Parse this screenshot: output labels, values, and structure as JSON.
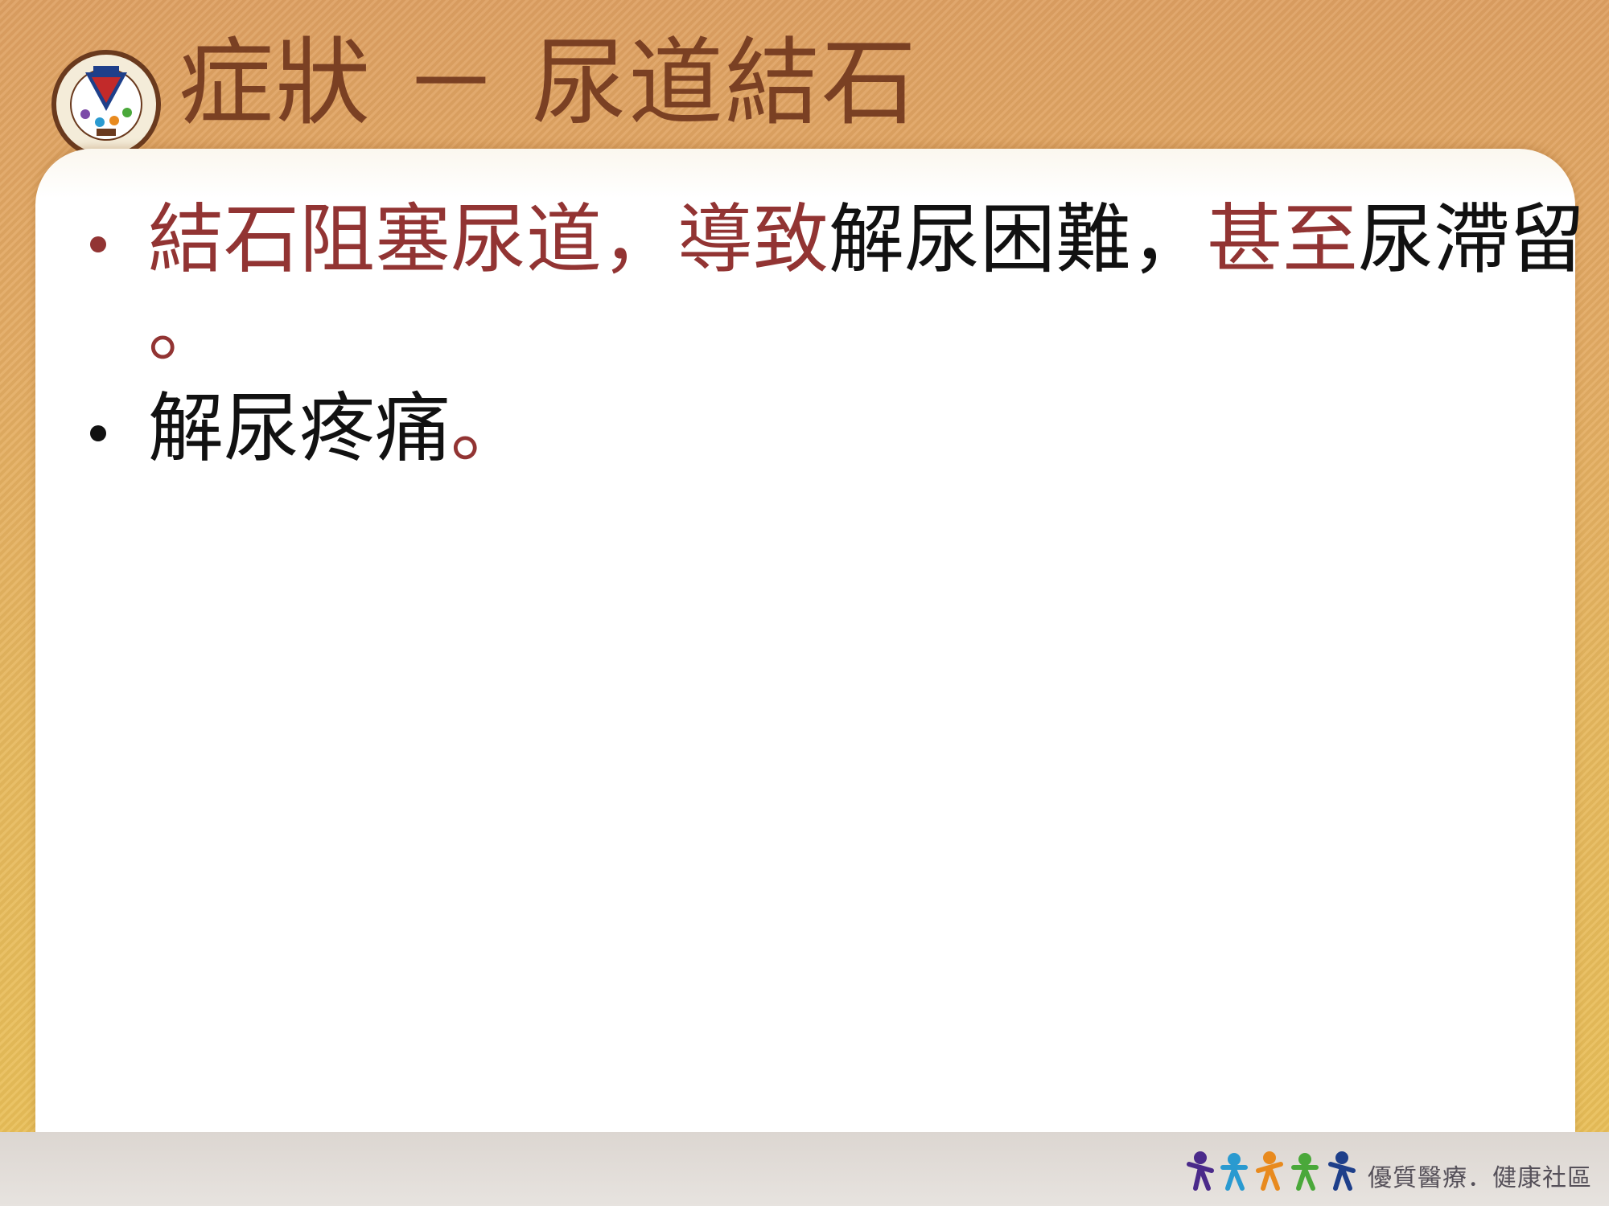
{
  "slide": {
    "title": "症狀 －  尿道結石"
  },
  "bullets": [
    {
      "line1": [
        {
          "text": "結石阻塞尿道，導致",
          "style": "red"
        },
        {
          "text": "解尿困難，",
          "style": "black"
        },
        {
          "text": "甚至",
          "style": "red"
        },
        {
          "text": "尿滯留",
          "style": "black"
        }
      ],
      "line2": "。"
    },
    {
      "line1": [
        {
          "text": "解尿疼痛",
          "style": "black"
        },
        {
          "text": "。",
          "style": "red"
        }
      ]
    }
  ],
  "footer": {
    "slogan": "優質醫療．健康社區"
  },
  "colors": {
    "title": "#7a4023",
    "accent_red": "#923433",
    "text_black": "#111111",
    "bullet_red": "#923433",
    "bullet_black": "#111111"
  },
  "icons": {
    "logo": "hospital-seal-icon",
    "footer": "people-figures-icon"
  }
}
